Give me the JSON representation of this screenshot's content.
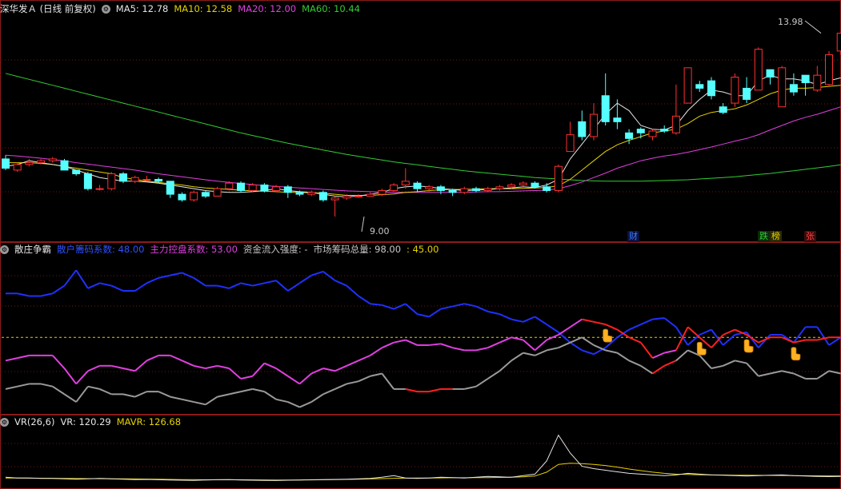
{
  "panel1": {
    "title": "深华发Ａ (日线 前复权)",
    "indicators": [
      {
        "label": "MA5:",
        "value": "12.78",
        "color": "#e6e6e6"
      },
      {
        "label": "MA10:",
        "value": "12.58",
        "color": "#e6d200"
      },
      {
        "label": "MA20:",
        "value": "12.00",
        "color": "#e040e0"
      },
      {
        "label": "MA60:",
        "value": "10.44",
        "color": "#33cc33"
      }
    ],
    "high_label": "13.98",
    "low_label": "9.00",
    "event_tags": [
      {
        "text": "财",
        "color": "#3b7cff",
        "bg": "#0b1240"
      },
      {
        "text": "跌",
        "color": "#33cc33",
        "bg": "#0b2a0b"
      },
      {
        "text": "榜",
        "color": "#e6d200",
        "bg": "#2a2a05"
      },
      {
        "text": "张",
        "color": "#ff4040",
        "bg": "#3a0b0b"
      }
    ]
  },
  "panel2": {
    "title": "散庄争霸",
    "items": [
      {
        "label": "散户籌码系数:",
        "value": "48.00",
        "color": "#3050ff"
      },
      {
        "label": "主力控盘系数:",
        "value": "53.00",
        "color": "#e040e0"
      },
      {
        "label": "资金流入强度:",
        "value": "-",
        "color": "#c8c8c8"
      },
      {
        "label": "市场筹码总量:",
        "value": "98.00",
        "color": "#c8c8c8"
      },
      {
        "label": ":",
        "value": "45.00",
        "color": "#e6d200"
      }
    ]
  },
  "panel3": {
    "title": "VR(26,6)",
    "items": [
      {
        "label": "VR:",
        "value": "120.29",
        "color": "#e6e6e6"
      },
      {
        "label": "MAVR:",
        "value": "126.68",
        "color": "#e6d200"
      }
    ]
  },
  "chart_data": [
    {
      "type": "candlestick",
      "title": "深华发Ａ (日线 前复权)",
      "ylim": [
        8.6,
        14.4
      ],
      "colors": {
        "up": "#ff3030",
        "down": "#55ffff",
        "ma5": "#e6e6e6",
        "ma10": "#e6d200",
        "ma20": "#e040e0",
        "ma60": "#33cc33"
      },
      "candles": [
        [
          10.6,
          10.35,
          10.7,
          10.3
        ],
        [
          10.3,
          10.45,
          10.5,
          10.25
        ],
        [
          10.45,
          10.5,
          10.6,
          10.4
        ],
        [
          10.5,
          10.55,
          10.6,
          10.45
        ],
        [
          10.55,
          10.6,
          10.65,
          10.5
        ],
        [
          10.55,
          10.3,
          10.6,
          10.3
        ],
        [
          10.3,
          10.2,
          10.3,
          10.15
        ],
        [
          10.2,
          9.8,
          10.25,
          9.75
        ],
        [
          9.8,
          9.8,
          9.9,
          9.75
        ],
        [
          9.8,
          10.2,
          10.25,
          9.75
        ],
        [
          10.2,
          10.0,
          10.25,
          9.95
        ],
        [
          10.0,
          10.1,
          10.15,
          9.95
        ],
        [
          10.05,
          10.05,
          10.15,
          10.0
        ],
        [
          10.05,
          10.0,
          10.1,
          9.95
        ],
        [
          10.0,
          9.65,
          10.0,
          9.55
        ],
        [
          9.65,
          9.5,
          9.7,
          9.45
        ],
        [
          9.5,
          9.7,
          9.75,
          9.45
        ],
        [
          9.7,
          9.6,
          9.75,
          9.55
        ],
        [
          9.6,
          9.8,
          9.85,
          9.6
        ],
        [
          9.8,
          9.95,
          10.0,
          9.75
        ],
        [
          9.95,
          9.75,
          10.0,
          9.7
        ],
        [
          9.75,
          9.9,
          9.95,
          9.7
        ],
        [
          9.9,
          9.75,
          9.95,
          9.7
        ],
        [
          9.75,
          9.85,
          9.9,
          9.7
        ],
        [
          9.85,
          9.7,
          9.9,
          9.55
        ],
        [
          9.7,
          9.65,
          9.75,
          9.6
        ],
        [
          9.65,
          9.7,
          9.75,
          9.6
        ],
        [
          9.7,
          9.5,
          9.75,
          9.45
        ],
        [
          9.5,
          9.55,
          9.6,
          9.05
        ],
        [
          9.55,
          9.6,
          9.65,
          9.5
        ],
        [
          9.6,
          9.6,
          9.65,
          9.55
        ],
        [
          9.6,
          9.65,
          9.7,
          9.6
        ],
        [
          9.65,
          9.75,
          9.8,
          9.6
        ],
        [
          9.75,
          9.9,
          9.95,
          9.7
        ],
        [
          9.9,
          10.0,
          10.35,
          9.8
        ],
        [
          9.95,
          9.8,
          10.0,
          9.7
        ],
        [
          9.8,
          9.85,
          9.9,
          9.7
        ],
        [
          9.85,
          9.75,
          9.9,
          9.65
        ],
        [
          9.75,
          9.7,
          9.8,
          9.6
        ],
        [
          9.7,
          9.8,
          9.85,
          9.65
        ],
        [
          9.8,
          9.75,
          9.85,
          9.7
        ],
        [
          9.75,
          9.8,
          9.85,
          9.7
        ],
        [
          9.8,
          9.85,
          9.9,
          9.75
        ],
        [
          9.85,
          9.9,
          9.95,
          9.8
        ],
        [
          9.9,
          9.95,
          10.0,
          9.85
        ],
        [
          9.95,
          9.85,
          10.0,
          9.8
        ],
        [
          9.85,
          9.75,
          9.95,
          9.7
        ],
        [
          9.75,
          10.4,
          10.45,
          9.7
        ],
        [
          10.8,
          11.25,
          11.6,
          10.9
        ],
        [
          11.6,
          11.2,
          11.9,
          11.1
        ],
        [
          11.2,
          11.8,
          12.1,
          11.1
        ],
        [
          12.3,
          11.6,
          12.9,
          11.5
        ],
        [
          11.7,
          11.6,
          12.2,
          11.4
        ],
        [
          11.3,
          11.15,
          11.4,
          11.0
        ],
        [
          11.4,
          11.3,
          11.45,
          11.15
        ],
        [
          11.2,
          11.35,
          11.4,
          11.1
        ],
        [
          11.4,
          11.35,
          11.5,
          11.3
        ],
        [
          11.3,
          11.75,
          12.6,
          11.25
        ],
        [
          12.1,
          13.05,
          13.05,
          12.2
        ],
        [
          12.6,
          12.5,
          12.7,
          12.4
        ],
        [
          12.7,
          12.3,
          12.8,
          12.2
        ],
        [
          12.0,
          11.85,
          12.1,
          11.8
        ],
        [
          12.1,
          12.8,
          12.9,
          12.0
        ],
        [
          12.5,
          12.2,
          12.8,
          12.1
        ],
        [
          12.45,
          13.55,
          13.6,
          12.45
        ],
        [
          13.0,
          12.8,
          13.0,
          12.6
        ],
        [
          12.0,
          13.05,
          13.1,
          12.0
        ],
        [
          12.6,
          12.4,
          12.9,
          12.3
        ],
        [
          12.85,
          12.65,
          12.85,
          12.3
        ],
        [
          12.45,
          12.85,
          13.1,
          12.4
        ],
        [
          12.6,
          13.4,
          13.5,
          12.55
        ],
        [
          13.5,
          13.98,
          13.98,
          13.4
        ]
      ],
      "ma5": [
        10.4,
        10.45,
        10.55,
        10.5,
        10.45,
        10.4,
        10.3,
        10.2,
        10.1,
        10.05,
        10.0,
        10.0,
        9.98,
        9.95,
        9.9,
        9.85,
        9.8,
        9.75,
        9.72,
        9.7,
        9.7,
        9.72,
        9.75,
        9.8,
        9.75,
        9.72,
        9.7,
        9.65,
        9.6,
        9.58,
        9.6,
        9.65,
        9.7,
        9.8,
        9.85,
        9.87,
        9.85,
        9.8,
        9.78,
        9.75,
        9.76,
        9.78,
        9.8,
        9.82,
        9.85,
        9.83,
        9.9,
        10.05,
        10.6,
        11.0,
        11.4,
        11.8,
        12.1,
        11.9,
        11.5,
        11.4,
        11.38,
        11.5,
        11.9,
        12.2,
        12.45,
        12.4,
        12.3,
        12.3,
        12.7,
        12.85,
        12.75,
        12.75,
        12.7,
        12.6,
        12.7,
        12.78
      ],
      "ma10": [
        10.5,
        10.5,
        10.5,
        10.48,
        10.45,
        10.4,
        10.35,
        10.3,
        10.25,
        10.2,
        10.1,
        10.05,
        10.0,
        9.97,
        9.93,
        9.9,
        9.85,
        9.82,
        9.8,
        9.78,
        9.76,
        9.74,
        9.73,
        9.72,
        9.7,
        9.7,
        9.69,
        9.68,
        9.65,
        9.62,
        9.62,
        9.62,
        9.64,
        9.66,
        9.7,
        9.72,
        9.75,
        9.77,
        9.78,
        9.78,
        9.79,
        9.8,
        9.8,
        9.8,
        9.81,
        9.82,
        9.83,
        9.88,
        10.05,
        10.3,
        10.55,
        10.8,
        10.98,
        11.1,
        11.2,
        11.3,
        11.35,
        11.4,
        11.55,
        11.75,
        11.85,
        11.9,
        11.95,
        12.05,
        12.2,
        12.35,
        12.45,
        12.5,
        12.5,
        12.52,
        12.55,
        12.58
      ],
      "ma20": [
        10.7,
        10.68,
        10.65,
        10.62,
        10.58,
        10.55,
        10.5,
        10.46,
        10.42,
        10.38,
        10.34,
        10.3,
        10.25,
        10.2,
        10.16,
        10.12,
        10.08,
        10.04,
        10.0,
        9.97,
        9.94,
        9.91,
        9.88,
        9.86,
        9.84,
        9.82,
        9.8,
        9.78,
        9.76,
        9.74,
        9.73,
        9.72,
        9.71,
        9.7,
        9.7,
        9.7,
        9.7,
        9.7,
        9.7,
        9.7,
        9.71,
        9.72,
        9.72,
        9.73,
        9.74,
        9.75,
        9.76,
        9.8,
        9.88,
        9.98,
        10.1,
        10.22,
        10.35,
        10.45,
        10.55,
        10.62,
        10.68,
        10.72,
        10.78,
        10.85,
        10.92,
        11.0,
        11.08,
        11.15,
        11.25,
        11.38,
        11.5,
        11.62,
        11.72,
        11.8,
        11.9,
        12.0
      ],
      "ma60": [
        12.9,
        12.82,
        12.74,
        12.66,
        12.58,
        12.5,
        12.42,
        12.34,
        12.26,
        12.18,
        12.1,
        12.02,
        11.94,
        11.86,
        11.78,
        11.7,
        11.62,
        11.54,
        11.46,
        11.38,
        11.3,
        11.23,
        11.16,
        11.09,
        11.02,
        10.96,
        10.9,
        10.84,
        10.78,
        10.72,
        10.67,
        10.62,
        10.57,
        10.52,
        10.48,
        10.44,
        10.4,
        10.36,
        10.32,
        10.28,
        10.25,
        10.22,
        10.19,
        10.16,
        10.13,
        10.1,
        10.08,
        10.06,
        10.04,
        10.02,
        10.01,
        10.0,
        10.0,
        10.0,
        10.0,
        10.01,
        10.02,
        10.03,
        10.04,
        10.06,
        10.08,
        10.1,
        10.12,
        10.15,
        10.18,
        10.21,
        10.25,
        10.28,
        10.32,
        10.36,
        10.4,
        10.44
      ]
    },
    {
      "type": "line",
      "title": "散庄争霸",
      "ylim": [
        -10,
        110
      ],
      "reference_line": 48,
      "series": [
        {
          "name": "散户籌码系数",
          "color": "#2030ff",
          "values": [
            82,
            82,
            80,
            80,
            82,
            88,
            100,
            86,
            90,
            88,
            84,
            84,
            90,
            94,
            96,
            98,
            94,
            88,
            88,
            86,
            90,
            88,
            90,
            92,
            84,
            90,
            96,
            99,
            92,
            88,
            80,
            74,
            73,
            70,
            74,
            66,
            64,
            70,
            72,
            74,
            72,
            68,
            66,
            62,
            60,
            64,
            58,
            52,
            44,
            38,
            35,
            40,
            48,
            54,
            58,
            62,
            63,
            56,
            42,
            50,
            54,
            42,
            50,
            52,
            40,
            50,
            50,
            44,
            56,
            56,
            42,
            48
          ]
        },
        {
          "name": "主力控盘系数",
          "color": "#e040e0",
          "secondary_color": "#ff2020",
          "values": [
            30,
            32,
            34,
            34,
            34,
            24,
            12,
            22,
            26,
            26,
            24,
            22,
            30,
            34,
            34,
            30,
            26,
            24,
            26,
            24,
            16,
            18,
            28,
            24,
            18,
            12,
            20,
            24,
            22,
            26,
            30,
            34,
            40,
            44,
            46,
            42,
            42,
            43,
            40,
            38,
            38,
            40,
            44,
            48,
            46,
            38,
            46,
            50,
            56,
            62,
            60,
            58,
            54,
            48,
            44,
            32,
            36,
            38,
            56,
            48,
            40,
            50,
            54,
            50,
            44,
            48,
            48,
            44,
            46,
            46,
            48,
            48
          ]
        },
        {
          "name": "市场筹码总量",
          "color": "#9a9a9a",
          "secondary_color": "#ff2020",
          "values": [
            8,
            10,
            12,
            12,
            10,
            4,
            -2,
            10,
            8,
            4,
            4,
            2,
            6,
            6,
            2,
            0,
            -2,
            -4,
            2,
            4,
            6,
            8,
            6,
            0,
            -2,
            -6,
            -2,
            4,
            8,
            12,
            14,
            18,
            20,
            8,
            8,
            6,
            6,
            8,
            8,
            8,
            10,
            16,
            22,
            30,
            36,
            34,
            38,
            40,
            44,
            48,
            42,
            38,
            36,
            30,
            26,
            20,
            26,
            30,
            38,
            34,
            24,
            26,
            30,
            28,
            18,
            20,
            22,
            20,
            16,
            16,
            22,
            20
          ]
        }
      ],
      "markers_at_index": [
        51,
        59,
        63,
        67
      ]
    },
    {
      "type": "line",
      "title": "VR(26,6)",
      "ylim": [
        0,
        800
      ],
      "series": [
        {
          "name": "VR",
          "color": "#e6e6e6",
          "values": [
            110,
            100,
            100,
            95,
            95,
            90,
            85,
            90,
            95,
            90,
            85,
            80,
            82,
            78,
            75,
            72,
            70,
            75,
            78,
            80,
            75,
            72,
            70,
            68,
            72,
            75,
            78,
            80,
            82,
            85,
            90,
            95,
            110,
            130,
            100,
            95,
            100,
            110,
            105,
            100,
            110,
            120,
            115,
            110,
            130,
            150,
            320,
            650,
            420,
            250,
            220,
            200,
            180,
            160,
            150,
            140,
            130,
            140,
            160,
            150,
            140,
            135,
            130,
            125,
            130,
            135,
            140,
            130,
            125,
            120,
            118,
            120.29
          ]
        },
        {
          "name": "MAVR",
          "color": "#e6d200",
          "values": [
            100,
            100,
            98,
            97,
            96,
            95,
            93,
            92,
            91,
            90,
            89,
            88,
            86,
            84,
            82,
            80,
            80,
            78,
            78,
            78,
            78,
            77,
            76,
            75,
            75,
            75,
            76,
            78,
            80,
            82,
            84,
            88,
            92,
            96,
            98,
            100,
            100,
            102,
            104,
            104,
            105,
            106,
            108,
            110,
            115,
            125,
            175,
            275,
            290,
            285,
            275,
            260,
            240,
            215,
            195,
            175,
            160,
            150,
            146,
            142,
            140,
            138,
            136,
            135,
            134,
            133,
            132,
            130,
            129,
            128,
            127,
            126.68
          ]
        }
      ]
    }
  ]
}
